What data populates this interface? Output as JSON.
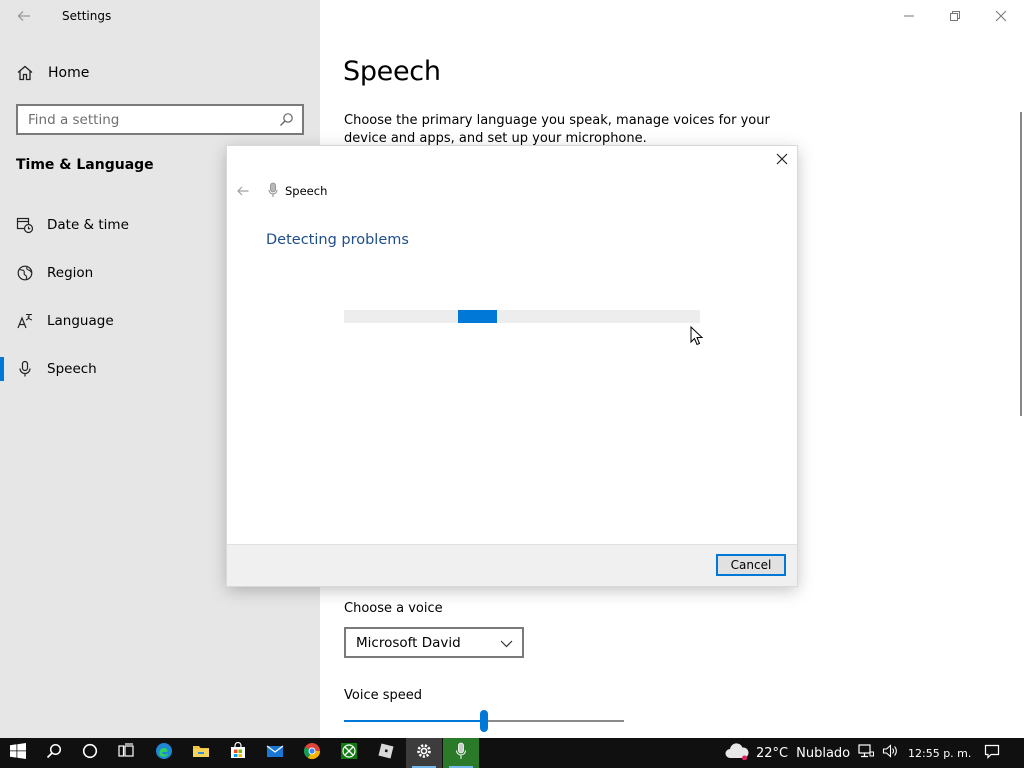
{
  "window": {
    "app_title": "Settings",
    "page_title": "Speech",
    "description": "Choose the primary language you speak, manage voices for your device and apps, and set up your microphone."
  },
  "sidebar": {
    "home_label": "Home",
    "search_placeholder": "Find a setting",
    "section_title": "Time & Language",
    "items": [
      {
        "label": "Date & time",
        "icon": "calendar-clock-icon"
      },
      {
        "label": "Region",
        "icon": "globe-icon"
      },
      {
        "label": "Language",
        "icon": "language-icon"
      },
      {
        "label": "Speech",
        "icon": "microphone-icon",
        "active": true
      }
    ]
  },
  "dialog": {
    "app_label": "Speech",
    "heading": "Detecting problems",
    "cancel_label": "Cancel",
    "progress_indeterminate": true
  },
  "voice": {
    "choose_label": "Choose a voice",
    "selected": "Microsoft David",
    "speed_label": "Voice speed",
    "speed_value": 0.5
  },
  "taskbar": {
    "apps": [
      "start-icon",
      "search-icon",
      "cortana-icon",
      "task-view-icon",
      "edge-icon",
      "file-explorer-icon",
      "store-icon",
      "mail-icon",
      "chrome-icon",
      "xbox-icon",
      "roblox-icon",
      "settings-icon",
      "microphone-icon"
    ],
    "weather_temp": "22°C",
    "weather_desc": "Nublado",
    "time": "12:55 p. m."
  },
  "colors": {
    "accent": "#0078d7",
    "sidebar_bg": "#e6e6e6",
    "taskbar_bg": "#101010",
    "dialog_heading": "#1f4e8a"
  }
}
